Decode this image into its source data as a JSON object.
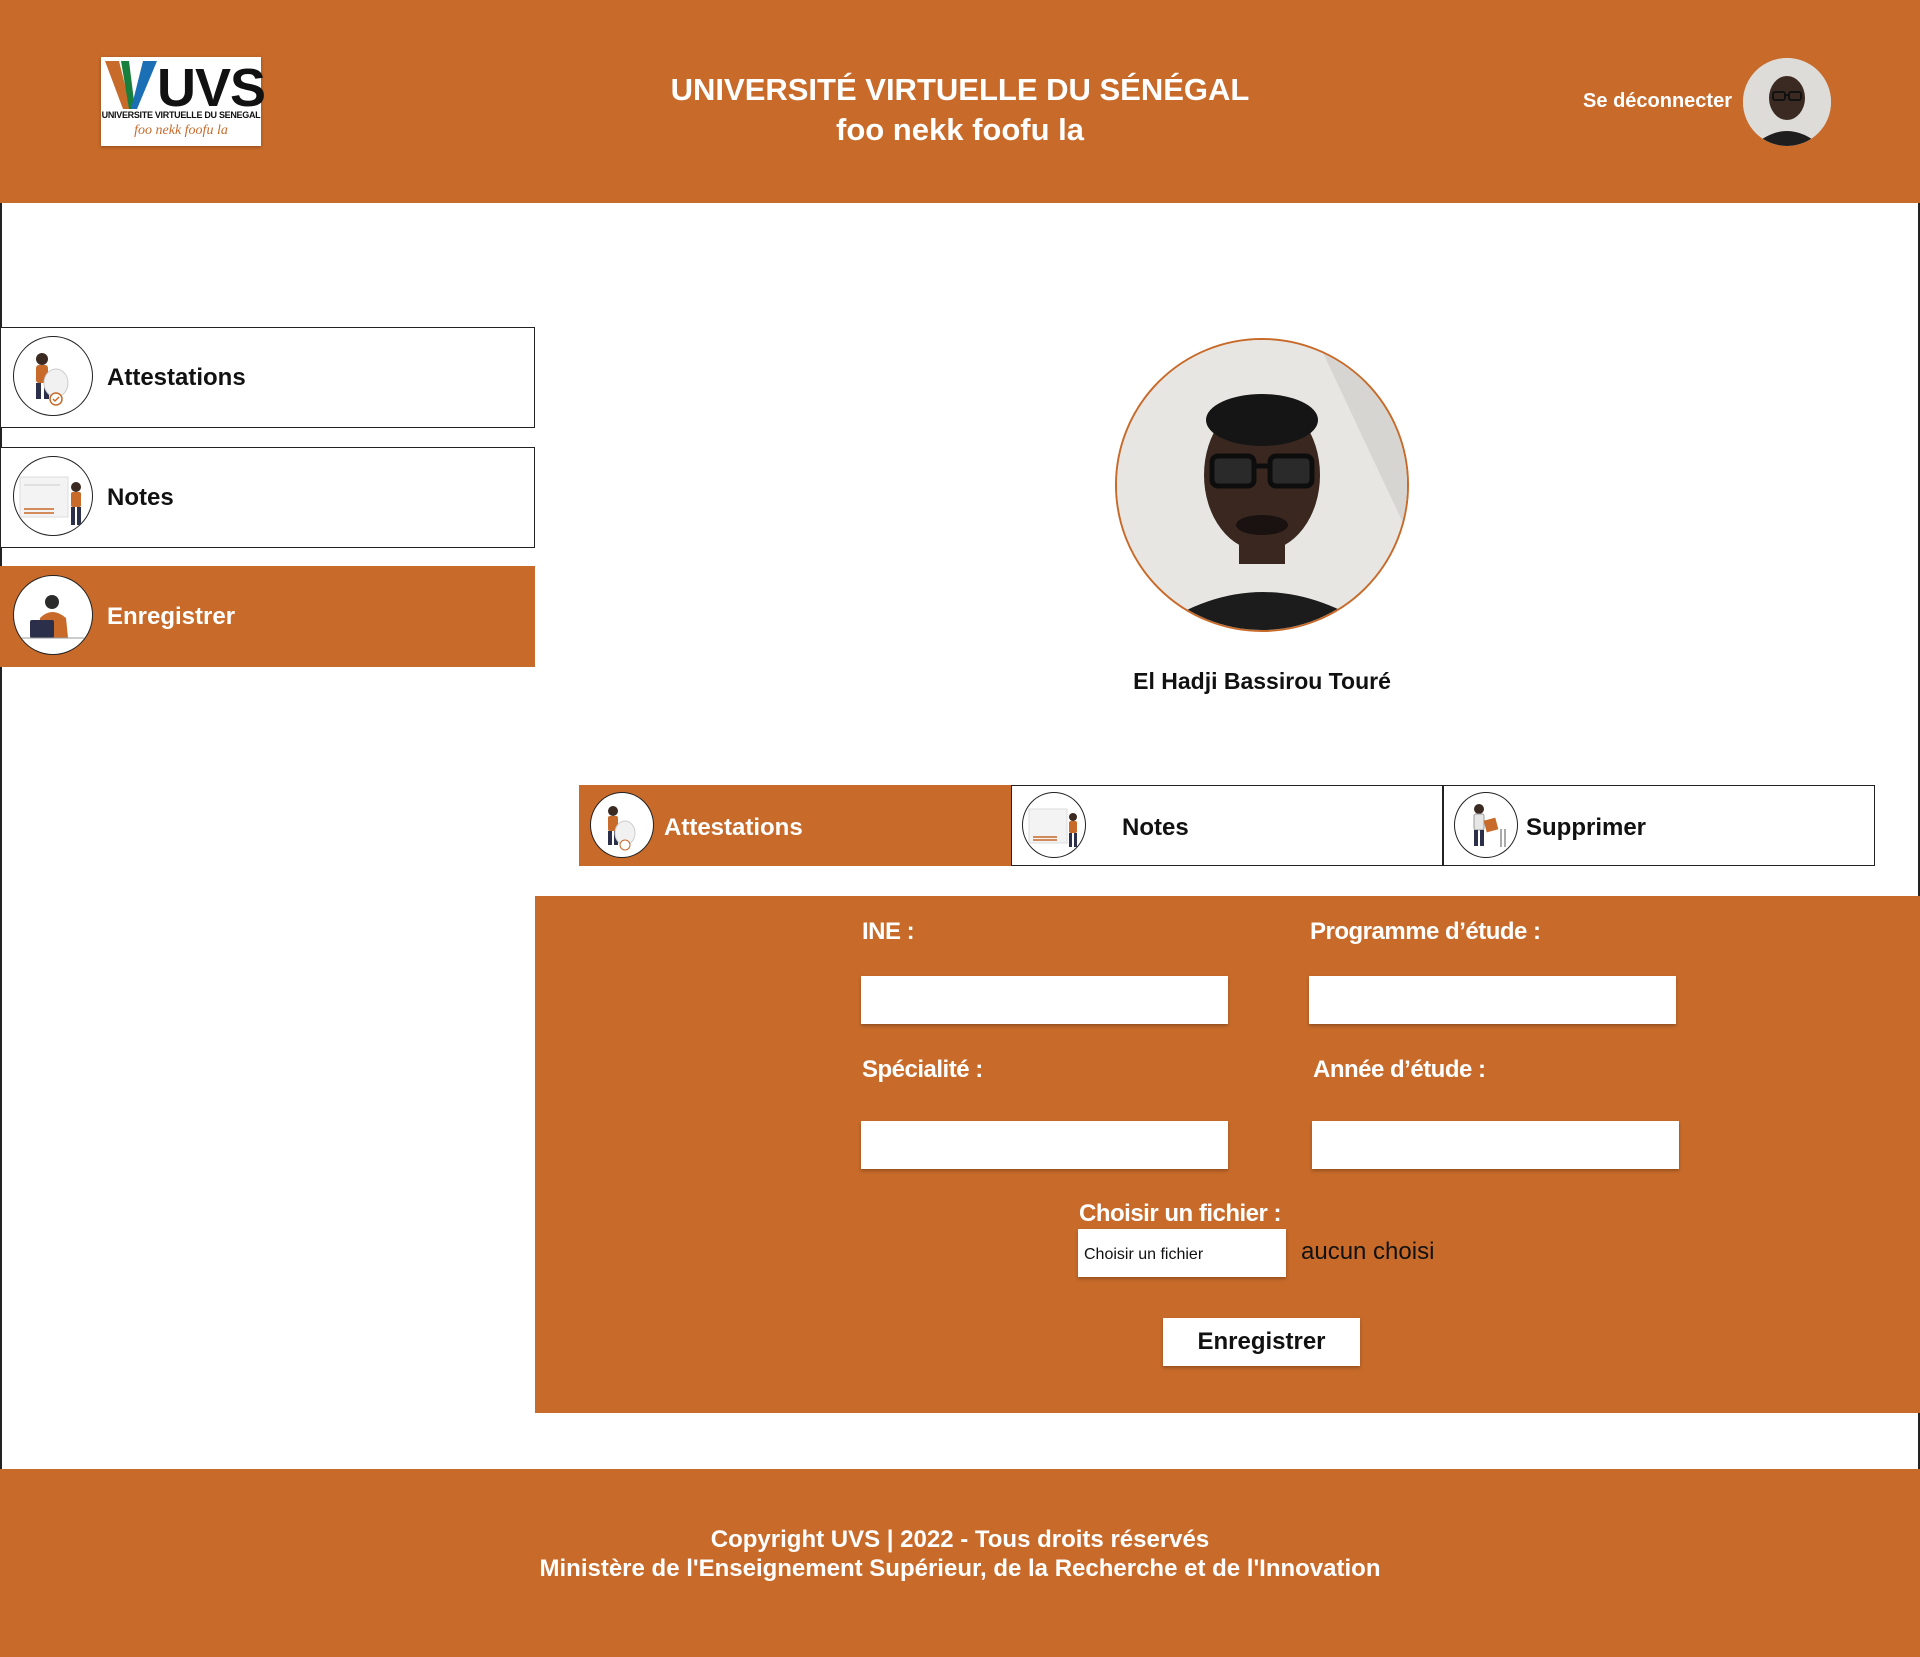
{
  "header": {
    "logo_text": "UVS",
    "logo_subtitle": "UNIVERSITE VIRTUELLE DU SENEGAL",
    "logo_motto": "foo nekk foofu la",
    "title_line1": "UNIVERSITÉ VIRTUELLE DU SÉNÉGAL",
    "title_line2": "foo nekk foofu la",
    "logout_label": "Se déconnecter"
  },
  "sidebar": {
    "items": [
      {
        "label": "Attestations",
        "icon": "attestation-illustration-icon",
        "active": false
      },
      {
        "label": "Notes",
        "icon": "notes-illustration-icon",
        "active": false
      },
      {
        "label": "Enregistrer",
        "icon": "register-illustration-icon",
        "active": true
      }
    ]
  },
  "profile": {
    "name": "El Hadji Bassirou Touré"
  },
  "tabs": [
    {
      "label": "Attestations",
      "active": true
    },
    {
      "label": "Notes",
      "active": false
    },
    {
      "label": "Supprimer",
      "active": false
    }
  ],
  "form": {
    "ine_label": "INE :",
    "programme_label": "Programme d’étude :",
    "specialite_label": "Spécialité :",
    "annee_label": "Année d’étude :",
    "file_label": "Choisir un fichier :",
    "file_button": "Choisir un fichier",
    "file_status": "aucun choisi",
    "submit_label": "Enregistrer"
  },
  "footer": {
    "copyright": "Copyright UVS | 2022 - Tous droits réservés",
    "ministry": "Ministère de l'Enseignement Supérieur, de la Recherche et de l'Innovation"
  },
  "colors": {
    "primary": "#c76a2a",
    "text": "#111111",
    "background": "#ffffff"
  }
}
